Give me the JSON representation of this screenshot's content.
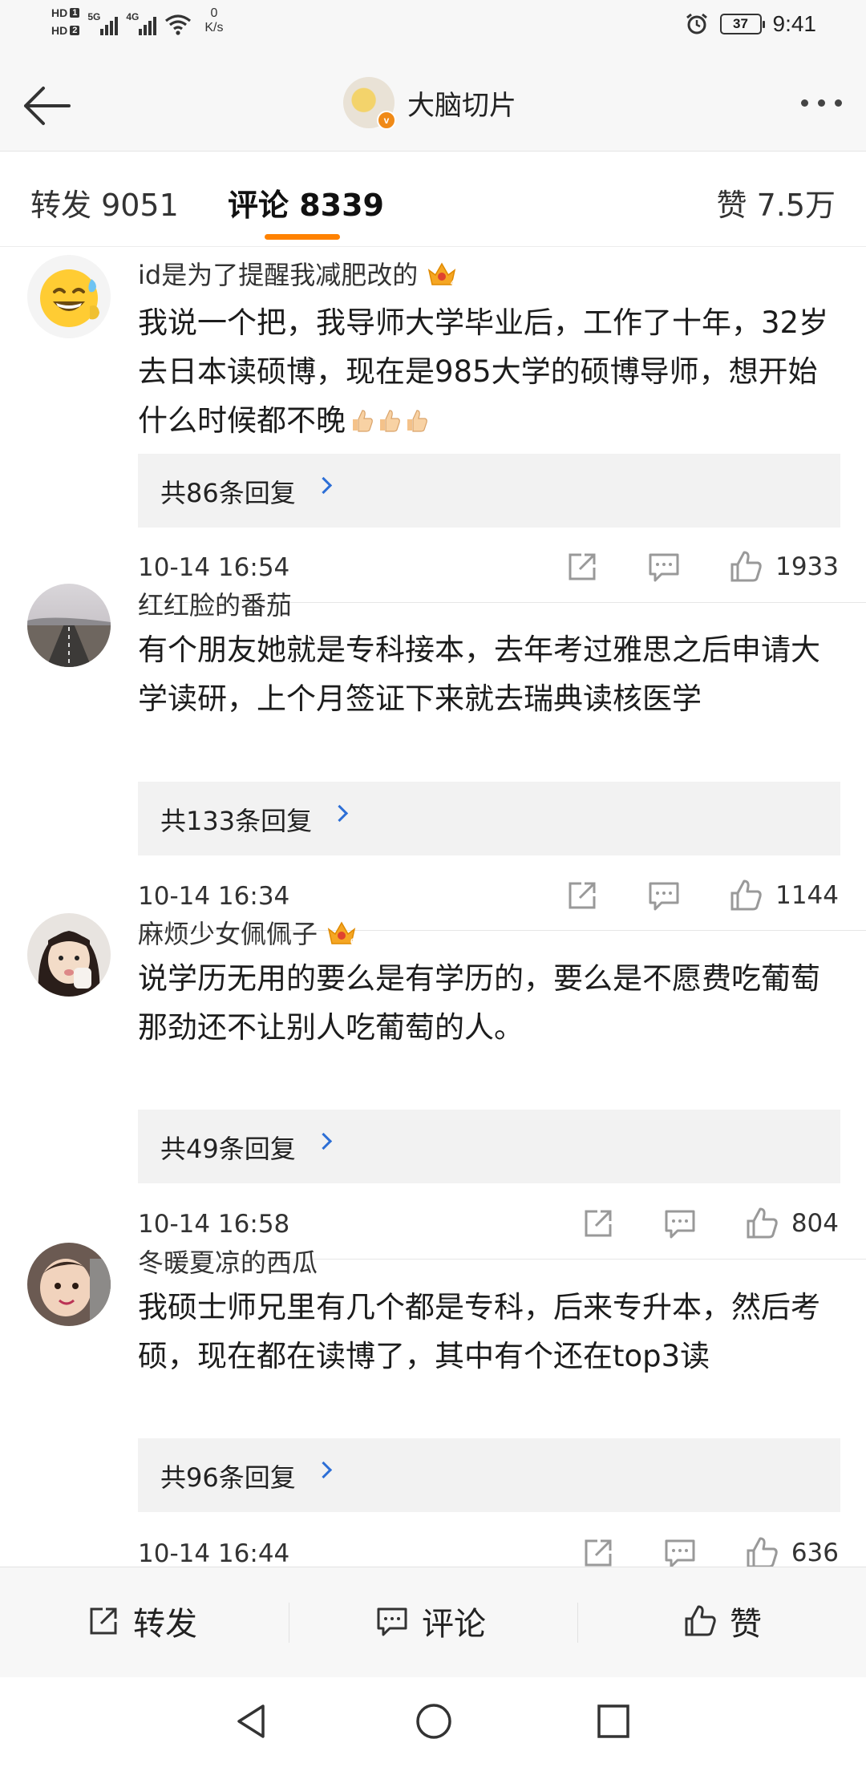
{
  "status_bar": {
    "hd1": "HD",
    "hd1_n": "1",
    "hd2": "HD",
    "hd2_n": "2",
    "sig1": "5G",
    "sig2": "4G",
    "net_speed": "0",
    "net_unit": "K/s",
    "battery": "37",
    "time": "9:41"
  },
  "header": {
    "title": "大脑切片",
    "verified": "v"
  },
  "tabs": {
    "repost": "转发 9051",
    "comments": "评论 8339",
    "likes": "赞 7.5万"
  },
  "comments": [
    {
      "user": "id是为了提醒我减肥改的",
      "crown_level": "4",
      "text": "我说一个把，我导师大学毕业后，工作了十年，32岁去日本读硕博，现在是985大学的硕博导师，想开始什么时候都不晚",
      "emoji_count": 3,
      "replies": "共86条回复",
      "time": "10-14 16:54",
      "likes": "1933"
    },
    {
      "user": "红红脸的番茄",
      "text": "有个朋友她就是专科接本，去年考过雅思之后申请大学读研，上个月签证下来就去瑞典读核医学",
      "replies": "共133条回复",
      "time": "10-14 16:34",
      "likes": "1144"
    },
    {
      "user": "麻烦少女佩佩子",
      "crown_level": "6",
      "text": "说学历无用的要么是有学历的，要么是不愿费吃葡萄那劲还不让别人吃葡萄的人。",
      "replies": "共49条回复",
      "time": "10-14 16:58",
      "likes": "804"
    },
    {
      "user": "冬暖夏凉的西瓜",
      "text": "我硕士师兄里有几个都是专科，后来专升本，然后考硕，现在都在读博了，其中有个还在top3读",
      "replies": "共96条回复",
      "time": "10-14 16:44",
      "likes": "636"
    }
  ],
  "toolbar": {
    "repost": "转发",
    "comment": "评论",
    "like": "赞"
  },
  "colors": {
    "accent": "#ff8200",
    "link": "#2d6fd6",
    "reply_bg": "#f2f2f2"
  }
}
